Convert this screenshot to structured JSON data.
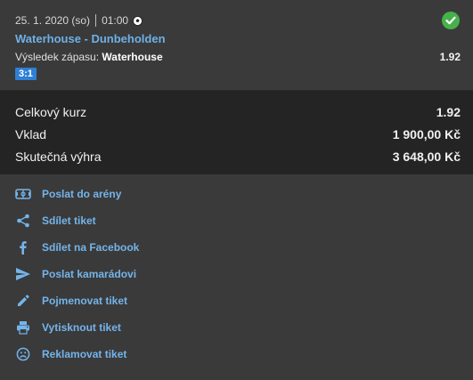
{
  "bet": {
    "date": "25. 1. 2020 (so)",
    "time": "01:00",
    "sport_icon": "soccer-ball-icon",
    "status_icon": "check-circle-icon",
    "match": "Waterhouse - Dunbeholden",
    "market_label": "Výsledek zápasu:",
    "selection": "Waterhouse",
    "odd": "1.92",
    "score": "3:1"
  },
  "totals": [
    {
      "label": "Celkový kurz",
      "value": "1.92"
    },
    {
      "label": "Vklad",
      "value": "1 900,00 Kč"
    },
    {
      "label": "Skutečná výhra",
      "value": "3 648,00 Kč"
    }
  ],
  "actions": [
    {
      "label": "Poslat do arény",
      "icon": "arena-icon"
    },
    {
      "label": "Sdílet tiket",
      "icon": "share-icon"
    },
    {
      "label": "Sdílet na Facebook",
      "icon": "facebook-icon"
    },
    {
      "label": "Poslat kamarádovi",
      "icon": "send-icon"
    },
    {
      "label": "Pojmenovat tiket",
      "icon": "pencil-icon"
    },
    {
      "label": "Vytisknout tiket",
      "icon": "printer-icon"
    },
    {
      "label": "Reklamovat tiket",
      "icon": "sad-face-icon"
    }
  ],
  "colors": {
    "accent": "#74b4ea",
    "success": "#46b14b",
    "score_badge": "#2e7fd6"
  }
}
